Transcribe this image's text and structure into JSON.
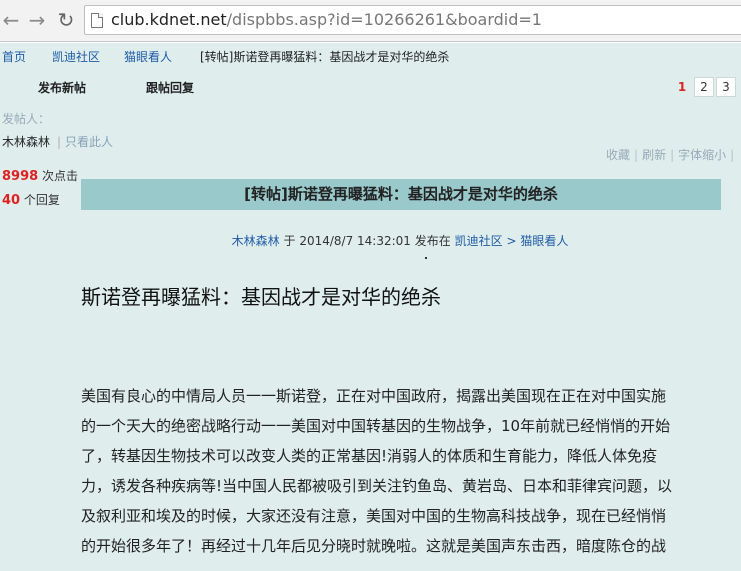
{
  "browser": {
    "url_host": "club.kdnet.net",
    "url_path": "/dispbbs.asp?id=10266261&boardid=1"
  },
  "breadcrumb": {
    "home": "首页",
    "community": "凯迪社区",
    "board": "猫眼看人",
    "current": "[转帖]斯诺登再曝猛料：基因战才是对华的绝杀"
  },
  "actions": {
    "new_post": "发布新帖",
    "reply": "跟帖回复"
  },
  "pagination": {
    "current": "1",
    "pages": [
      "2",
      "3"
    ]
  },
  "author_panel": {
    "label": "发帖人：",
    "name": "木林森林",
    "only_this": "只看此人",
    "clicks": "8998",
    "clicks_label": "次点击",
    "replies": "40",
    "replies_label": "个回复"
  },
  "tools": {
    "favorite": "收藏",
    "refresh": "刷新",
    "font_smaller": "字体缩小"
  },
  "post": {
    "title_bar": "[转帖]斯诺登再曝猛料：基因战才是对华的绝杀",
    "meta_author": "木林森林",
    "meta_at": "于",
    "meta_time": "2014/8/7 14:32:01",
    "meta_published": "发布在",
    "meta_community": "凯迪社区",
    "meta_arrow": ">",
    "meta_board": "猫眼看人",
    "headline": "斯诺登再曝猛料：基因战才是对华的绝杀",
    "body_lines": [
      "美国有良心的中情局人员一一斯诺登，正在对中国政府，揭露出美国现在正在对中国实施",
      "的一个天大的绝密战略行动一一美国对中国转基因的生物战争，10年前就已经悄悄的开始",
      "了，转基因生物技术可以改变人类的正常基因!消弱人的体质和生育能力，降低人体免疫",
      "力，诱发各种疾病等!当中国人民都被吸引到关注钓鱼岛、黄岩岛、日本和菲律宾问题，以",
      "及叙利亚和埃及的时候，大家还没有注意，美国对中国的生物高科技战争，现在已经悄悄",
      "的开始很多年了！再经过十几年后见分晓时就晚啦。这就是美国声东击西，暗度陈仓的战"
    ]
  }
}
